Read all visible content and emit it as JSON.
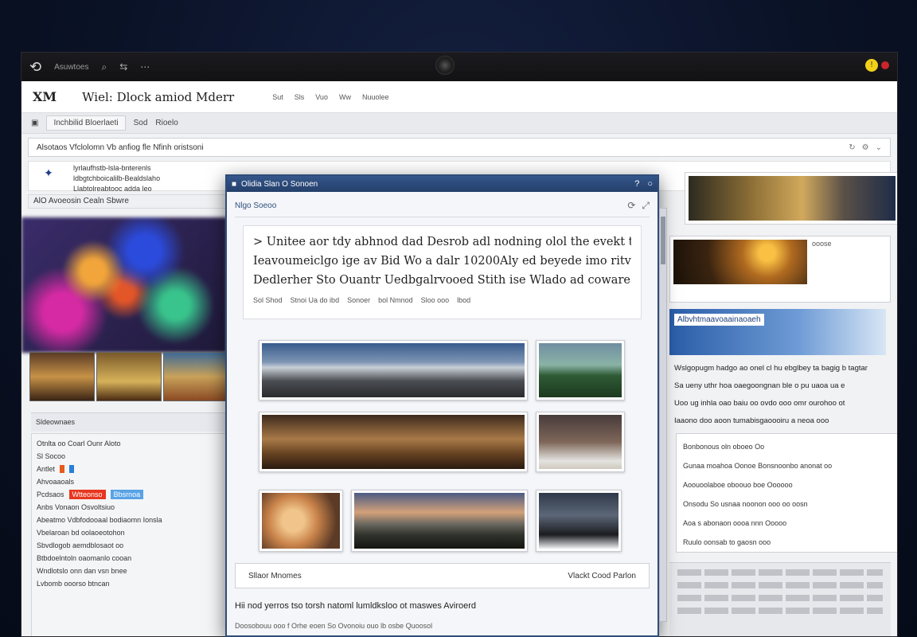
{
  "bezel": {
    "app_label": "Asuwtoes",
    "icons": [
      "search-icon",
      "share-icon",
      "more-icon"
    ]
  },
  "back_window": {
    "brand": "XM",
    "title": "Wiel: Dlock amiod Mderr",
    "menu": [
      "Sut",
      "Sls",
      "Vuo",
      "Ww",
      "Nuuolee"
    ],
    "tabs": [
      "Inchbilid Bloerlaeti",
      "Sod",
      "Rioelo"
    ],
    "address": "Alsotaos Vfclolomn  Vb anfiog fle  Nfinh oristsoni",
    "intro": [
      "lyrlaufhstb-lsla-bnterenls",
      "ldbgtchboicalilb-Bealdslaho",
      "Llabtolreabtooc adda leo"
    ],
    "crumb": "AlO  Avoeosin  Cealn Sbwre",
    "left_label": "Sldeownaes",
    "left_list": [
      "Otnlta oo Coarl Ounr Aloto",
      "Sl Socoo",
      "Antlet",
      "Ahvoaaoals",
      "Pcdsaos",
      "Wtteonso",
      "Bbsrnoa",
      "Anbs Vonaon Osvoltsiuo",
      "Abeatmo Vdbfodooaal bodiaomn Ionsla",
      "Vbelaroan bd oolaoeotohon",
      "Sbvdlogob aemdblosaot oo",
      "Btbdoelntoln oaomanlo cooan",
      "Wndlotslo onn dan vsn bnee",
      "Lvbomb ooorso btncan"
    ],
    "right_note": "ooose",
    "right_header": "Albvhtmaavoaainaoaeh",
    "right_text": [
      "Wslgopugm hadgo ao onel cl hu ebglbey ta bagig b tagtar",
      "Sa ueny uthr hoa oaegoongnan ble o pu uaoa ua e",
      "Uoo ug inhla oao baiu oo ovdo ooo omr ourohoo ot",
      "Iaaono doo aoon tumabisgaoooiru a neoa ooo"
    ],
    "right_list": [
      "Bonbonous oln oboeo Oo",
      "Gunaa moahoa Oonoe Bonsnoonbo anonat oo",
      "Aoouoolaboe oboouo boe Oooooo",
      "Onsodu So usnaa noonon ooo oo oosn",
      "Aoa s abonaon oooa nnn Ooooo",
      "Ruulo oonsab to gaosn ooo"
    ]
  },
  "dialog": {
    "title": "Olidia Slan O Sonoen",
    "sub_label": "Nlgo Soeoo",
    "quote": [
      "> Unitee aor tdy abhnod dad Desrob adl nodning olol the evekt tomienvines -",
      "Ieavoumeiclgo ige av Bid Wo a dalr 10200Aly ed beyede imo ritve ylvers",
      "Dedlerher Sto Ouantr Uedbgalrvooed Stith ise Wlado ad coware Ohoker"
    ],
    "quote_meta": [
      "Sol Shod",
      "Stnoi Ua do ibd",
      "Sonoer",
      "bol Nmnod",
      "Sloo ooo",
      "lbod"
    ],
    "footer_left": "Sllaor Mnomes",
    "footer_right": "Vlackt Cood Parlon",
    "caption": "Hii nod yerros tso torsh natoml lumldksloo ot maswes Aviroerd",
    "caption2": "Doosobouu ooo f Orhe eoen So Ovonoiu ouo lb osbe Quoosol"
  }
}
